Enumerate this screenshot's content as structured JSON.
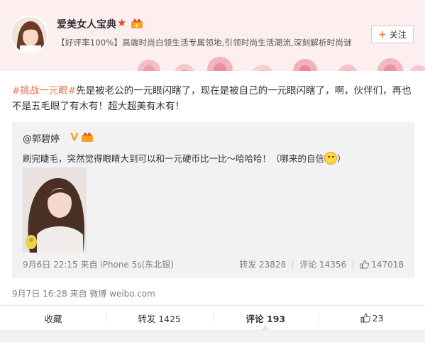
{
  "header": {
    "account_name": "爱美女人宝典",
    "description": "【好评率100%】高端时尚白领生活专属领地,引领时尚生活潮流,深刻解析时尚谜",
    "follow_label": "关注"
  },
  "post": {
    "topic": "#挑战一元眼#",
    "text": "先是被老公的一元眼闪瞎了，现在是被自己的一元眼闪瞎了，啊，伙伴们，再也不是五毛眼了有木有！超大超美有木有！",
    "meta": "9月7日 16:28 来自 微博 weibo.com"
  },
  "repost": {
    "user": "@郭碧婷",
    "text": "刷完睫毛，突然觉得眼睛大到可以和一元硬币比一比～哈哈哈！（哪来的自信",
    "text_end": "）",
    "meta": "9月6日 22:15 来自 iPhone 5s(东北银)",
    "forward": "转发 23828",
    "comment": "评论 14356",
    "likes": "147018"
  },
  "actions": {
    "collect": "收藏",
    "forward": "转发 1425",
    "comment": "评论 193",
    "like": "23"
  },
  "colors": {
    "topic": "#eb7350",
    "header_bg": "#fdeef0",
    "repost_bg": "#f2f2f5"
  }
}
